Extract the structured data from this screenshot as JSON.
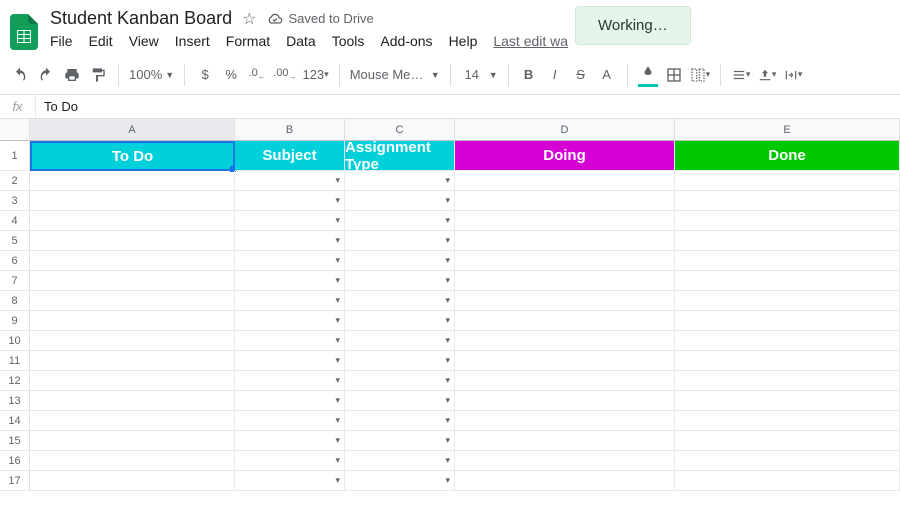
{
  "doc": {
    "title": "Student Kanban Board",
    "saved_status": "Saved to Drive",
    "last_edit": "Last edit wa",
    "working": "Working…"
  },
  "menu": {
    "file": "File",
    "edit": "Edit",
    "view": "View",
    "insert": "Insert",
    "format": "Format",
    "data": "Data",
    "tools": "Tools",
    "addons": "Add-ons",
    "help": "Help"
  },
  "toolbar": {
    "zoom": "100%",
    "dollar": "$",
    "percent": "%",
    "dec_dec": ".0",
    "dec_inc": ".00",
    "numfmt": "123",
    "font": "Mouse Me…",
    "font_size": "14",
    "bold": "B",
    "italic": "I",
    "strike": "S",
    "textA": "A"
  },
  "formula_bar": {
    "value": "To Do"
  },
  "columns": [
    "A",
    "B",
    "C",
    "D",
    "E"
  ],
  "rows": [
    "1",
    "2",
    "3",
    "4",
    "5",
    "6",
    "7",
    "8",
    "9",
    "10",
    "11",
    "12",
    "13",
    "14",
    "15",
    "16",
    "17"
  ],
  "headers": {
    "todo": "To Do",
    "subject": "Subject",
    "assignment_type": "Assignment Type",
    "doing": "Doing",
    "done": "Done"
  },
  "colors": {
    "cyan": "#00d0d9",
    "magenta": "#d400d4",
    "green": "#00c800",
    "selection": "#1a73e8"
  }
}
